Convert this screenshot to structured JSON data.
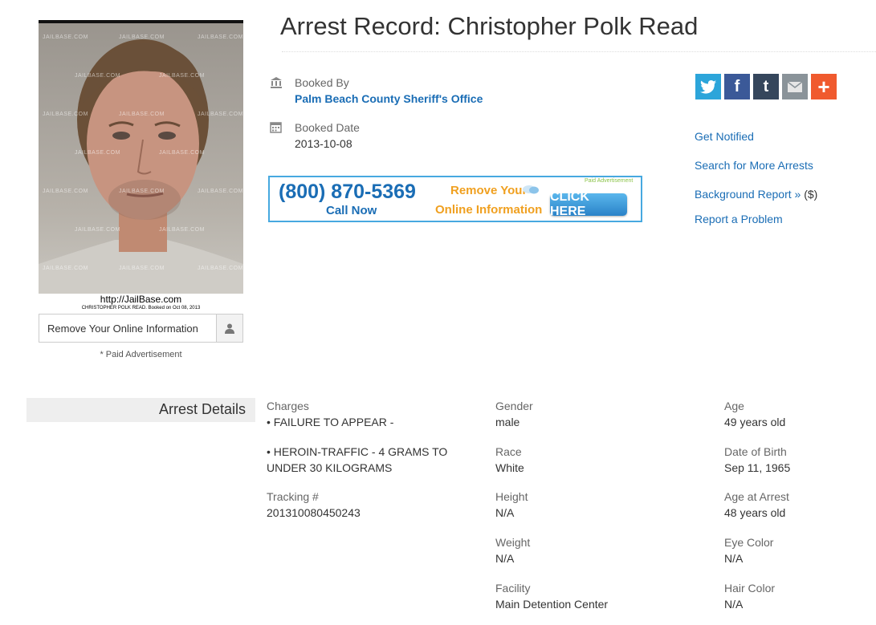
{
  "page": {
    "title": "Arrest Record: Christopher Polk Read"
  },
  "mugshot": {
    "watermark": "JAILBASE.COM",
    "url": "http://JailBase.com",
    "caption": "CHRISTOPHER POLK READ.  Booked on Oct 08, 2013"
  },
  "remove_box": {
    "label": "Remove Your Online Information",
    "icon": "user-icon"
  },
  "paid_ad_note": "* Paid Advertisement",
  "booking": {
    "booked_by_label": "Booked By",
    "booked_by_value": "Palm Beach County Sheriff's Office",
    "booked_date_label": "Booked Date",
    "booked_date_value": "2013-10-08"
  },
  "banner": {
    "phone": "(800) 870-5369",
    "call_now": "Call Now",
    "remove_your": "Remove Your",
    "online_information": "Online Information",
    "click_here": "CLICK HERE",
    "paid_advertisement": "Paid Advertisement"
  },
  "social": [
    {
      "name": "twitter",
      "glyph": "t",
      "color": "#2ca5da"
    },
    {
      "name": "facebook",
      "glyph": "f",
      "color": "#3b5998"
    },
    {
      "name": "tumblr",
      "glyph": "t",
      "color": "#35465c"
    },
    {
      "name": "email",
      "glyph": "✉",
      "color": "#8a9399"
    },
    {
      "name": "more",
      "glyph": "+",
      "color": "#f05a2e"
    }
  ],
  "side_links": {
    "get_notified": "Get Notified",
    "search_more": "Search for More Arrests",
    "background_report": "Background Report »",
    "background_report_suffix": "($)",
    "report_problem": "Report a Problem"
  },
  "details": {
    "heading": "Arrest Details",
    "charges_label": "Charges",
    "charge_1": "• FAILURE TO APPEAR -",
    "charge_2_line1": "• HEROIN-TRAFFIC - 4 GRAMS TO",
    "charge_2_line2": "UNDER 30 KILOGRAMS",
    "tracking_label": "Tracking #",
    "tracking_value": "201310080450243",
    "gender_label": "Gender",
    "gender_value": "male",
    "race_label": "Race",
    "race_value": "White",
    "height_label": "Height",
    "height_value": "N/A",
    "weight_label": "Weight",
    "weight_value": "N/A",
    "facility_label": "Facility",
    "facility_value": "Main Detention Center",
    "age_label": "Age",
    "age_value": "49 years old",
    "dob_label": "Date of Birth",
    "dob_value": "Sep 11, 1965",
    "age_arrest_label": "Age at Arrest",
    "age_arrest_value": "48 years old",
    "eye_label": "Eye Color",
    "eye_value": "N/A",
    "hair_label": "Hair Color",
    "hair_value": "N/A"
  }
}
